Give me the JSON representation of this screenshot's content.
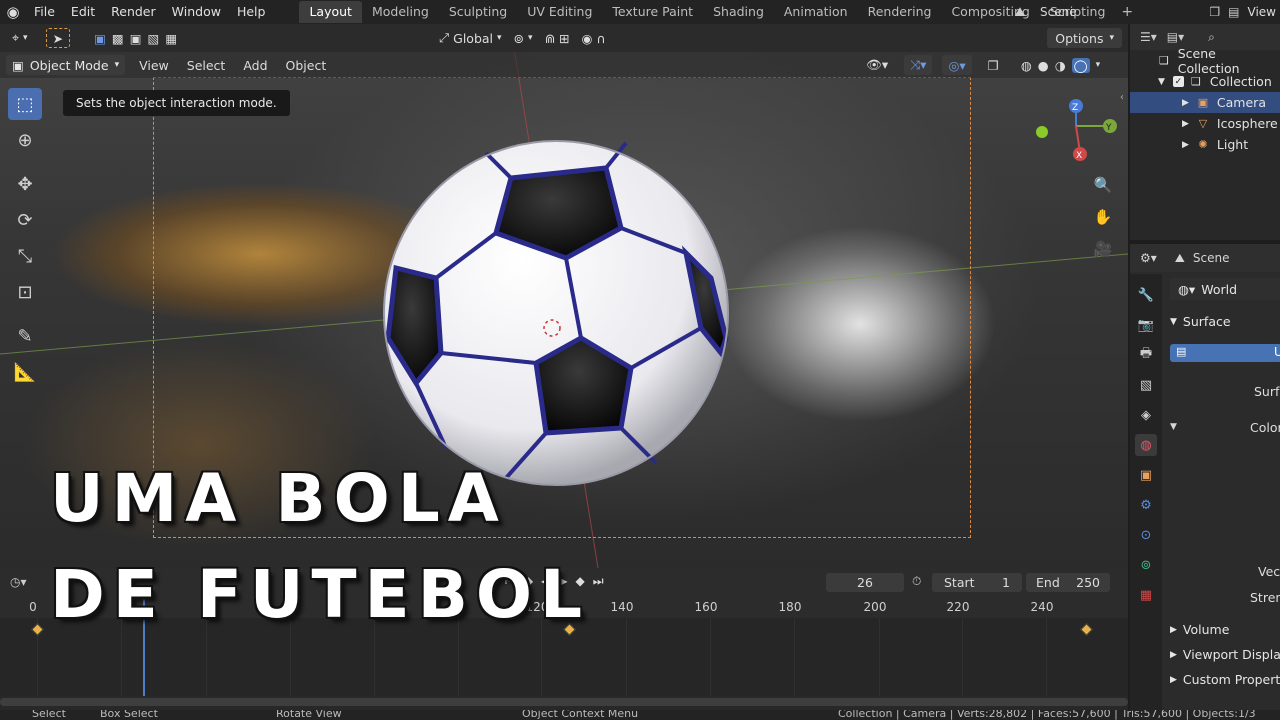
{
  "menu": [
    "File",
    "Edit",
    "Render",
    "Window",
    "Help"
  ],
  "workspaces": [
    "Layout",
    "Modeling",
    "Sculpting",
    "UV Editing",
    "Texture Paint",
    "Shading",
    "Animation",
    "Rendering",
    "Compositing",
    "Scripting"
  ],
  "active_workspace": "Layout",
  "scene_name": "Scene",
  "view_layer_label": "View",
  "toolbar": {
    "orientation": "Global",
    "options_label": "Options"
  },
  "viewport_header": {
    "mode": "Object Mode",
    "menus": [
      "View",
      "Select",
      "Add",
      "Object"
    ]
  },
  "tooltip": "Sets the object interaction mode.",
  "overlay_title": {
    "line1": "UMA BOLA",
    "line2": "DE FUTEBOL"
  },
  "timeline": {
    "current_frame": "26",
    "start_label": "Start",
    "start": "1",
    "end_label": "End",
    "end": "250",
    "ticks": [
      "0",
      "120",
      "140",
      "160",
      "180",
      "200",
      "220",
      "240"
    ]
  },
  "statusbar": {
    "select": "Select",
    "box_select": "Box Select",
    "rotate_view": "Rotate View",
    "context_menu": "Object Context Menu",
    "stats": "Collection | Camera | Verts:28,802 | Faces:57,600 | Tris:57,600 | Objects:1/3"
  },
  "outliner": {
    "root": "Scene Collection",
    "collection": "Collection",
    "items": [
      "Camera",
      "Icosphere",
      "Light"
    ],
    "selected": "Camera"
  },
  "properties": {
    "header_scene": "Scene",
    "world_name": "World",
    "surface_panel": "Surface",
    "use_nodes_label": "Us",
    "surface_label": "Surface",
    "color_label": "Color",
    "vector_label": "Vector",
    "strength_label": "Strength",
    "panels": [
      "Volume",
      "Viewport Display",
      "Custom Properti"
    ]
  },
  "colors": {
    "accent_blue": "#4772b3",
    "selection_blue": "#334d80",
    "keyframe": "#e6b34a",
    "camera_frame": "#e08a40"
  }
}
